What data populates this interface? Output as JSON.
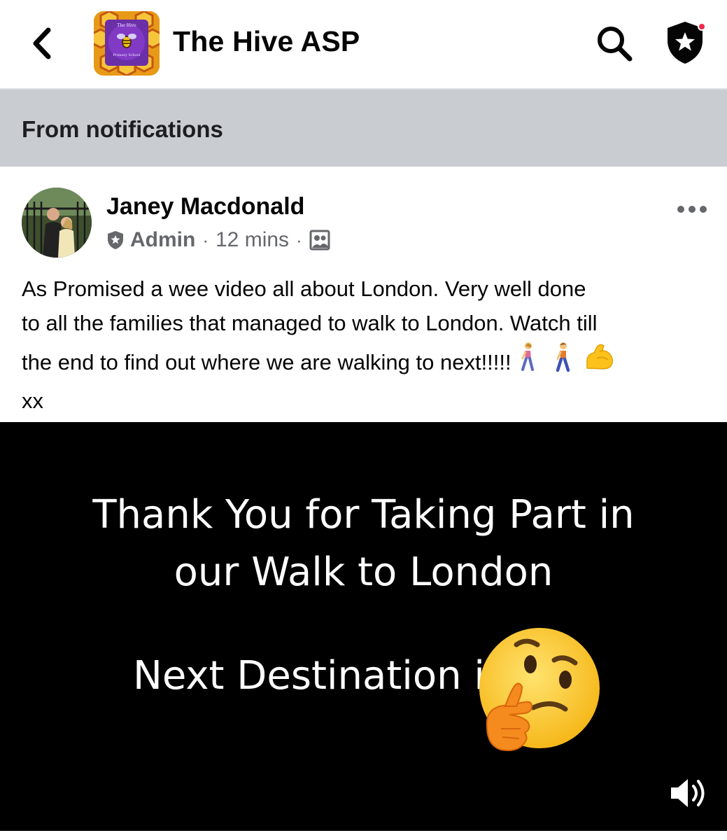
{
  "header": {
    "group_name": "The Hive ASP",
    "logo_small_text": "The Hive",
    "logo_bottom_text": "Primary School",
    "icons": {
      "back": "chevron-left-icon",
      "search": "search-icon",
      "admin": "shield-star-icon"
    }
  },
  "context": {
    "label": "From notifications"
  },
  "post": {
    "author": "Janey Macdonald",
    "role": "Admin",
    "time": "12 mins",
    "separator": "·",
    "audience_icon": "group-members-icon",
    "body_lines": [
      "As Promised a wee video all about London. Very well done",
      "to all the families that managed to walk to London. Watch till",
      "the end to find out where we are walking to next!!!!!",
      "xx"
    ],
    "emojis": [
      "woman-walking",
      "man-walking",
      "flexed-biceps"
    ]
  },
  "video": {
    "title_line1": "Thank You for Taking Part in",
    "title_line2": "our Walk to London",
    "next_text": "Next Destination is",
    "emoji": "thinking-face",
    "volume_icon": "volume-icon"
  },
  "colors": {
    "banner_bg": "#c9ccd1",
    "meta_text": "#65676b",
    "notification_dot": "#f02849",
    "video_bg": "#000000",
    "emoji_yellow": "#fbc02d"
  }
}
